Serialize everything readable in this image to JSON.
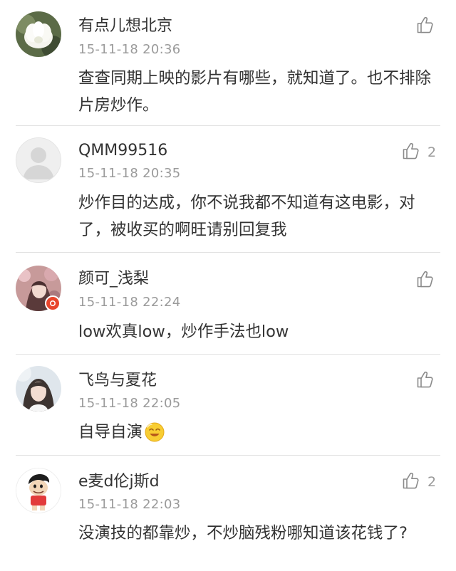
{
  "comments": [
    {
      "username": "有点儿想北京",
      "timestamp": "15-11-18 20:36",
      "text": "查查同期上映的影片有哪些，就知道了。也不排除片房炒作。",
      "likes": ""
    },
    {
      "username": "QMM99516",
      "timestamp": "15-11-18 20:35",
      "text": "炒作目的达成，你不说我都不知道有这电影，对了，被收买的啊旺请别回复我",
      "likes": "2"
    },
    {
      "username": "颜可_浅梨",
      "timestamp": "15-11-18 22:24",
      "text": "low欢真low，炒作手法也low",
      "likes": ""
    },
    {
      "username": "飞鸟与夏花",
      "timestamp": "15-11-18 22:05",
      "text": "自导自演",
      "likes": ""
    },
    {
      "username": "e麦d伦j斯d",
      "timestamp": "15-11-18 22:03",
      "text": "没演技的都靠炒，不炒脑残粉哪知道该花钱了?",
      "likes": "2"
    }
  ],
  "icons": {
    "like": "thumbs-up-icon",
    "emoji": "smiling-face-emoji-icon",
    "verified": "verified-badge-icon"
  },
  "colors": {
    "text": "#333333",
    "meta": "#9a9a9a",
    "divider": "#e2e2e2",
    "badge": "#e8452c"
  }
}
